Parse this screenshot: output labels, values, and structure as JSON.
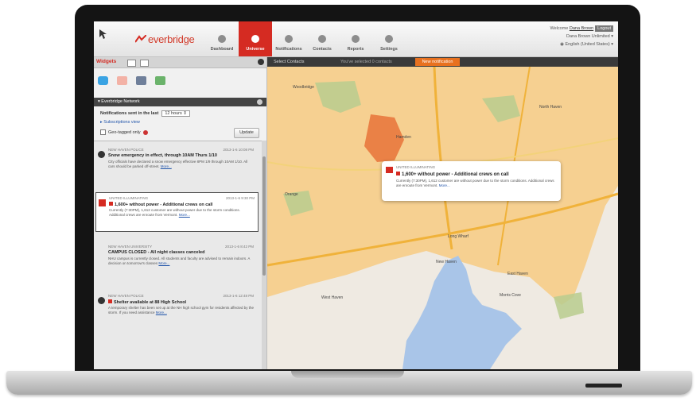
{
  "app": {
    "brand": "everbridge",
    "accent": "#d52b22"
  },
  "nav": {
    "items": [
      {
        "label": "Dashboard",
        "icon": "dashboard-icon",
        "active": false
      },
      {
        "label": "Universe",
        "icon": "universe-icon",
        "active": true
      },
      {
        "label": "Notifications",
        "icon": "notifications-icon",
        "active": false
      },
      {
        "label": "Contacts",
        "icon": "contacts-icon",
        "active": false
      },
      {
        "label": "Reports",
        "icon": "reports-icon",
        "active": false
      },
      {
        "label": "Settings",
        "icon": "settings-icon",
        "active": false
      }
    ]
  },
  "user": {
    "welcome": "Welcome",
    "name": "Dana Brown",
    "logout": "Logout",
    "org": "Dana Brown Unlimited",
    "language": "English (United States)"
  },
  "widgets": {
    "title": "Widgets"
  },
  "network": {
    "title": "Everbridge Network",
    "notifications_label": "Notifications sent in the last",
    "period": "12 hours",
    "subscriptions_link": "Subscriptions view",
    "geo_label": "Geo-tagged only",
    "update_button": "Update"
  },
  "alerts": [
    {
      "source": "NEW HAVEN POLICE",
      "time": "2013-1-6 10:08 PM",
      "title": "Snow emergency in effect, through 10AM Thurs 1/10",
      "body": "City officials have declared a snow emergency effective 8PM 1/9 through 10AM 1/10. All cars should be parked off-street.",
      "more": "More..."
    },
    {
      "source": "UNITED ILLUMINATING",
      "time": "2013-1-6 9:30 PM",
      "title": "1,600+ without power - Additional crews on call",
      "body": "Currently (7:30PM), 1,612 customer are without power due to the storm conditions. Additional crews are enroute from Vermont.",
      "more": "More..."
    },
    {
      "source": "NEW HAVEN UNIVERSITY",
      "time": "2013-1-6 8:42 PM",
      "title": "CAMPUS CLOSED - All night classes canceled",
      "body": "NHU campus is currently closed. All students and faculty are advised to remain indoors. A decision on tomorrow's classes",
      "more": "More..."
    },
    {
      "source": "NEW HAVEN POLICE",
      "time": "2013-1-6 12:48 PM",
      "title": "Shelter available at 88 High School",
      "body": "A temporary shelter has been set up at the NH high school gym for residents affected by the storm. If you need assistance",
      "more": "More..."
    }
  ],
  "mapbar": {
    "select_contacts": "Select Contacts",
    "selected": "You've selected 0 contacts",
    "new_notification": "New notification"
  },
  "popup": {
    "source": "UNITED ILLUMINATING",
    "title": "1,600+ without power - Additional crews on call",
    "body": "Currently (7:30PM), 1,612 customer are without power due to the storm conditions. Additional crews are enroute from Vermont.",
    "more": "More..."
  },
  "map_labels": [
    "Hamden",
    "Woodbridge",
    "New Haven",
    "West Haven",
    "East Haven",
    "North Haven",
    "Orange",
    "Long Wharf",
    "Morris Cove"
  ]
}
